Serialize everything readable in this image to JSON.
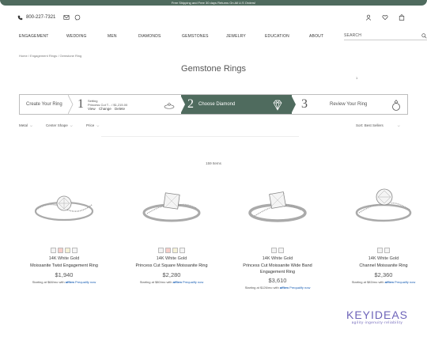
{
  "promo": "Free Shipping and Free 30 days Returns On All U.S Orders!",
  "topbar": {
    "phone": "800-227-7321"
  },
  "nav": {
    "items": [
      "ENGAGEMENT",
      "WEDDING",
      "MEN",
      "DIAMONDS",
      "GEMSTONES",
      "JEWELRY",
      "EDUCATION",
      "ABOUT"
    ],
    "search_label": "SEARCH"
  },
  "breadcrumb": [
    "Home",
    "/",
    "Engagement Rings",
    "/",
    "Gemstone Ring"
  ],
  "page_title": "Gemstone Rings",
  "tiny_num": "1",
  "steps": {
    "create": "Create Your Ring",
    "setting_num": "1",
    "setting_label": "Setting",
    "setting_info": "Princess Cut T... / $1,215.00",
    "setting_links": [
      "View",
      "Change",
      "Delete"
    ],
    "choose_num": "2",
    "choose_label": "Choose Diamond",
    "review_num": "3",
    "review_label": "Review Your Ring"
  },
  "filters": {
    "metal": "Metal",
    "center_shape": "Center Shape",
    "price": "Price",
    "sort": "Sort: Best Sellers"
  },
  "count": "159 Items",
  "products": [
    {
      "metal": "14K White Gold",
      "name": "Moissanite Twist Engagement Ring",
      "price": "$1,940",
      "finance_prefix": "Starting at $68/mo with",
      "affirm": "affirm",
      "prequalify": "Prequalify now",
      "swatches": [
        "#f2f2f2",
        "#f7cfc9",
        "#f5f1d6",
        "#f4f4f4"
      ]
    },
    {
      "metal": "14K White Gold",
      "name": "Princess Cut Square Moissanite Ring",
      "price": "$2,280",
      "finance_prefix": "Starting at $80/mo with",
      "affirm": "affirm",
      "prequalify": "Prequalify now",
      "swatches": [
        "#f2f2f2",
        "#f7cfc9",
        "#f5f1d6",
        "#f4f4f4"
      ]
    },
    {
      "metal": "14K White Gold",
      "name": "Princess Cut Moissanite Wide Band Engagement Ring",
      "price": "$3,610",
      "finance_prefix": "Starting at $126/mo with",
      "affirm": "affirm",
      "prequalify": "Prequalify now",
      "swatches": [
        "#f2f2f2",
        "#f4f4f4"
      ]
    },
    {
      "metal": "14K White Gold",
      "name": "Channel Moissanite Ring",
      "price": "$2,360",
      "finance_prefix": "Starting at $83/mo with",
      "affirm": "affirm",
      "prequalify": "Prequalify now",
      "swatches": [
        "#f2f2f2",
        "#f4f4f4"
      ]
    }
  ],
  "watermark": {
    "name": "KEYIDEAS",
    "tagline": "agility·ingenuity·reliability"
  },
  "colors": {
    "accent": "#4f6b5e",
    "affirm": "#1a5fb4",
    "watermark": "#6e64b9"
  }
}
